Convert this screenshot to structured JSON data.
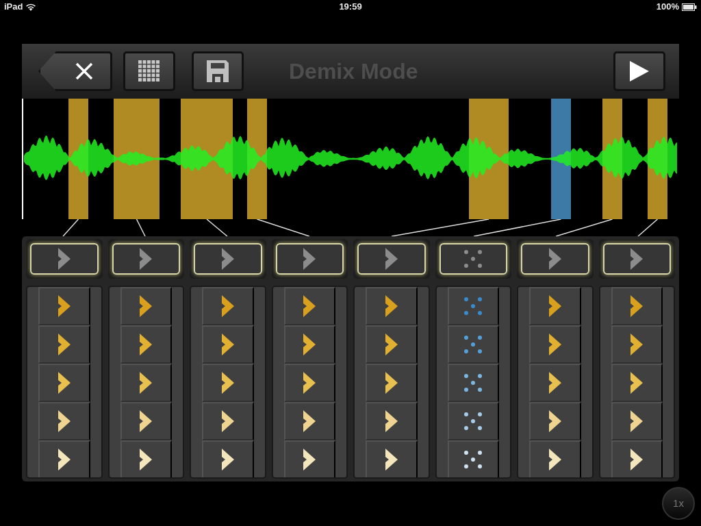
{
  "status_bar": {
    "device": "iPad",
    "time": "19:59",
    "battery": "100%"
  },
  "toolbar": {
    "title": "Demix Mode"
  },
  "waveform": {
    "segments": [
      {
        "color": "#b08a22"
      },
      {
        "color": "#b08a22"
      },
      {
        "color": "#b08a22"
      },
      {
        "color": "#b08a22"
      },
      {
        "color": "#b08a22"
      },
      {
        "color": "#3d7aa6"
      },
      {
        "color": "#b08a22"
      },
      {
        "color": "#b08a22"
      }
    ]
  },
  "channels": [
    {
      "kind": "arrow"
    },
    {
      "kind": "arrow"
    },
    {
      "kind": "arrow"
    },
    {
      "kind": "arrow"
    },
    {
      "kind": "arrow"
    },
    {
      "kind": "dots"
    },
    {
      "kind": "arrow"
    },
    {
      "kind": "arrow"
    }
  ],
  "speed_button": "1x"
}
